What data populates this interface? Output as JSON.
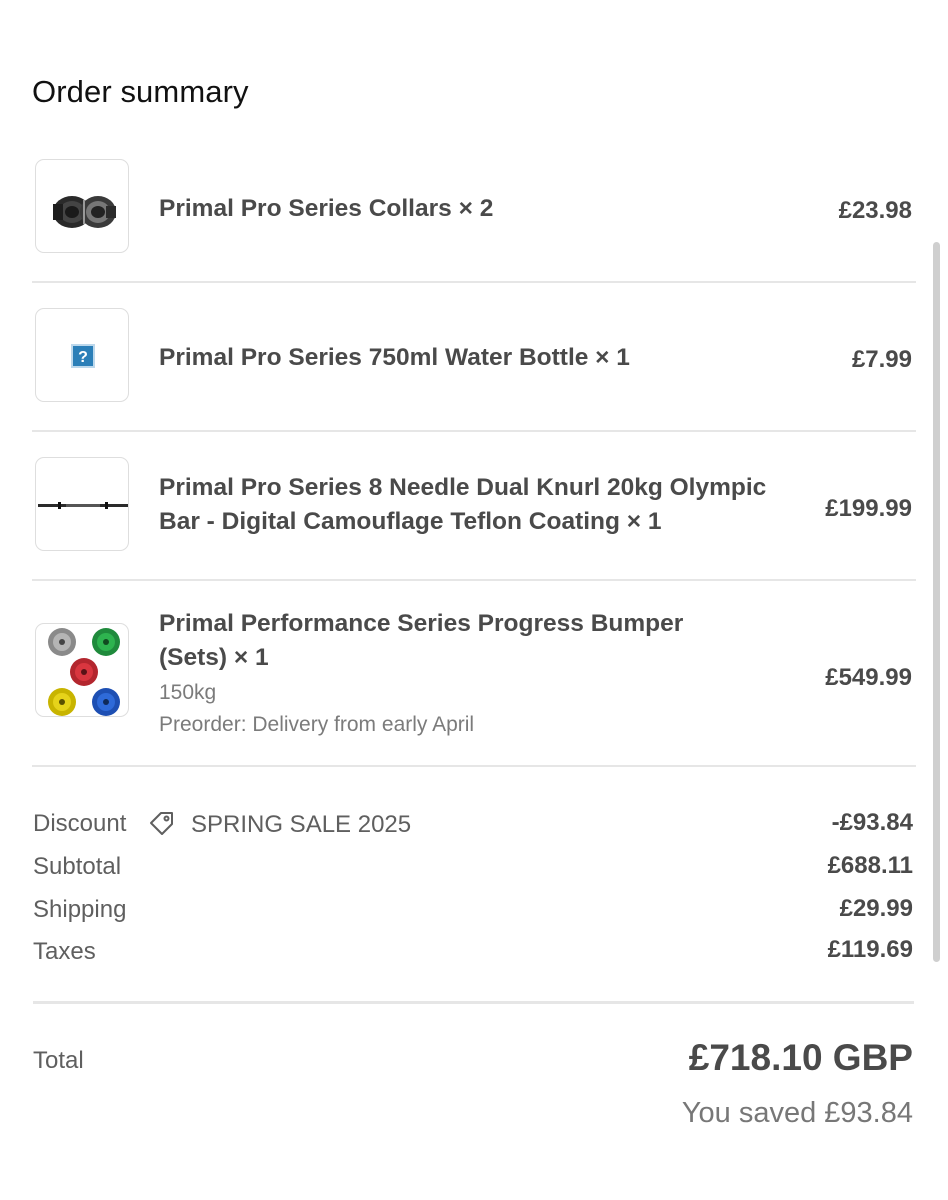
{
  "order_summary": {
    "title": "Order summary",
    "items": [
      {
        "name": "Primal Pro Series Collars × 2",
        "price": "£23.98",
        "icon": "collar-image"
      },
      {
        "name": "Primal Pro Series 750ml Water Bottle × 1",
        "price": "£7.99",
        "icon": "placeholder-question-icon"
      },
      {
        "name": "Primal Pro Series 8 Needle Dual Knurl 20kg Olympic Bar - Digital Camouflage Teflon Coating × 1",
        "price": "£199.99",
        "icon": "barbell-image"
      },
      {
        "name": "Primal Performance Series Progress Bumper (Sets) × 1",
        "variant": "150kg",
        "note": "Preorder: Delivery from early April",
        "price": "£549.99",
        "icon": "bumper-plates-image"
      }
    ],
    "discount": {
      "label": "Discount",
      "code": "SPRING SALE 2025",
      "value": "-£93.84",
      "icon": "tag-icon"
    },
    "subtotal": {
      "label": "Subtotal",
      "value": "£688.11"
    },
    "shipping": {
      "label": "Shipping",
      "value": "£29.99"
    },
    "taxes": {
      "label": "Taxes",
      "value": "£119.69"
    },
    "total": {
      "label": "Total",
      "value": "£718.10 GBP",
      "saved": "You saved £93.84"
    }
  },
  "colors": {
    "text_primary": "#4a4a4a",
    "text_secondary": "#5f5f5f",
    "divider": "#e6e6e6",
    "placeholder_icon": "#2b7fb8"
  }
}
